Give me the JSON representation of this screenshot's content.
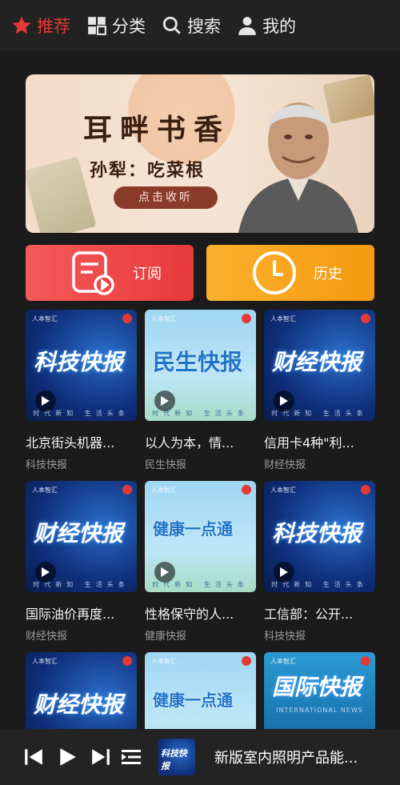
{
  "nav": {
    "items": [
      {
        "label": "推荐",
        "icon": "star-icon",
        "active": true
      },
      {
        "label": "分类",
        "icon": "grid-icon",
        "active": false
      },
      {
        "label": "搜索",
        "icon": "search-icon",
        "active": false
      },
      {
        "label": "我的",
        "icon": "user-icon",
        "active": false
      }
    ],
    "active_color": "#e53935"
  },
  "banner": {
    "title": "耳畔书香",
    "subtitle": "孙犁：吃菜根",
    "cta": "点击收听"
  },
  "actions": {
    "subscribe": {
      "label": "订阅",
      "icon": "subscribe-icon",
      "color": "#ef4545"
    },
    "history": {
      "label": "历史",
      "icon": "clock-icon",
      "color": "#f7a21b"
    }
  },
  "cards": [
    {
      "title": "北京街头机器...",
      "category": "科技快报",
      "art": "科技快报"
    },
    {
      "title": "以人为本，情...",
      "category": "民生快报",
      "art": "民生快报"
    },
    {
      "title": "信用卡4种\"利...",
      "category": "财经快报",
      "art": "财经快报"
    },
    {
      "title": "国际油价再度...",
      "category": "财经快报",
      "art": "财经快报"
    },
    {
      "title": "性格保守的人...",
      "category": "健康快报",
      "art": "健康一点通"
    },
    {
      "title": "工信部：公开...",
      "category": "科技快报",
      "art": "科技快报"
    },
    {
      "title": "",
      "category": "",
      "art": "财经快报"
    },
    {
      "title": "",
      "category": "",
      "art": "健康一点通"
    },
    {
      "title": "",
      "category": "",
      "art": "国际快报"
    }
  ],
  "card_text": {
    "brand": "人本智汇",
    "strip": "时代新知 生活头条",
    "intl_sub": "INTERNATIONAL NEWS"
  },
  "player": {
    "now_playing": "新版室内照明产品能...",
    "thumb_art": "科技快报",
    "controls": [
      "previous-icon",
      "play-icon",
      "next-icon",
      "playlist-icon"
    ]
  }
}
